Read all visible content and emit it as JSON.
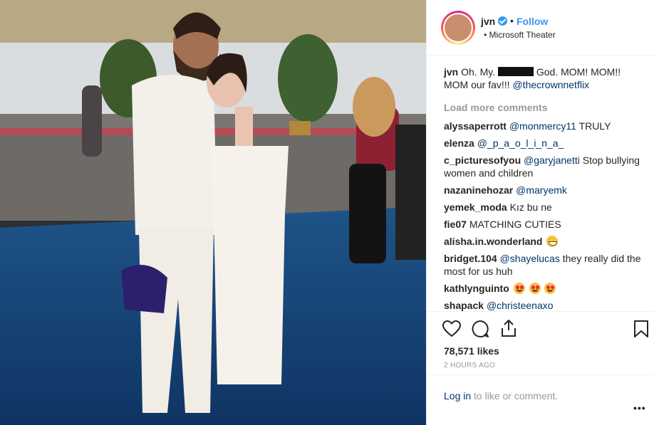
{
  "post": {
    "username": "jvn",
    "follow_label": "Follow",
    "separator": "•",
    "location_prefix": "•",
    "location": "Microsoft Theater"
  },
  "caption": {
    "username": "jvn",
    "text_before": "Oh. My.",
    "text_after": "God. MOM! MOM!! MOM our fav!!!",
    "mention": "@thecrownnetflix"
  },
  "load_more_label": "Load more comments",
  "comments": [
    {
      "username": "alyssaperrott",
      "mention": "@monmercy11",
      "text": "TRULY"
    },
    {
      "username": "elenza",
      "mention": "@_p_a_o_l_i_n_a_",
      "text": ""
    },
    {
      "username": "c_picturesofyou",
      "mention": "@garyjanetti",
      "text": "Stop bullying women and children"
    },
    {
      "username": "nazaninehozar",
      "mention": "@maryemk",
      "text": ""
    },
    {
      "username": "yemek_moda",
      "mention": "",
      "text": "Kız bu ne"
    },
    {
      "username": "fie07",
      "mention": "",
      "text": "MATCHING CUTIES"
    },
    {
      "username": "alisha.in.wonderland",
      "mention": "",
      "text": ""
    },
    {
      "username": "bridget.104",
      "mention": "@shayelucas",
      "text": "they really did the most for us huh"
    },
    {
      "username": "kathlynguinto",
      "mention": "",
      "text": ""
    },
    {
      "username": "shapack",
      "mention": "@christeenaxo",
      "text": ""
    }
  ],
  "likes": "78,571 likes",
  "timestamp": "2 HOURS AGO",
  "login": {
    "link": "Log in",
    "rest": "to like or comment."
  },
  "more_options": "•••",
  "icons": [
    "heart-icon",
    "comment-icon",
    "share-icon",
    "bookmark-icon",
    "verified-badge-icon"
  ],
  "colors": {
    "link_blue": "#3897f0",
    "mention_navy": "#003569",
    "muted": "#999999",
    "text": "#262626"
  }
}
